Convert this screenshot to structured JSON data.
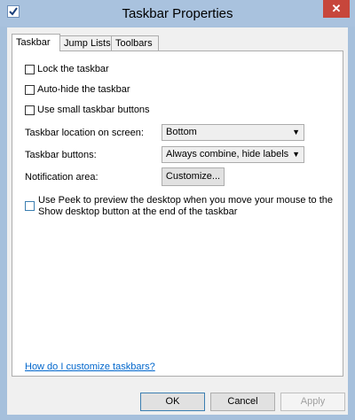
{
  "window": {
    "title": "Taskbar Properties",
    "close_label": "✕",
    "app_icon": "taskbar-properties-icon"
  },
  "tabs": [
    {
      "label": "Taskbar",
      "active": true
    },
    {
      "label": "Jump Lists",
      "active": false
    },
    {
      "label": "Toolbars",
      "active": false
    }
  ],
  "taskbar": {
    "lock_label": "Lock the taskbar",
    "lock_checked": false,
    "autohide_label": "Auto-hide the taskbar",
    "autohide_checked": false,
    "small_buttons_label": "Use small taskbar buttons",
    "small_buttons_checked": false,
    "location_label": "Taskbar location on screen:",
    "location_value": "Bottom",
    "buttons_label": "Taskbar buttons:",
    "buttons_value": "Always combine, hide labels",
    "notification_label": "Notification area:",
    "customize_label": "Customize...",
    "peek_label": "Use Peek to preview the desktop when you move your mouse to the Show desktop button at the end of the taskbar",
    "peek_checked": false,
    "help_link": "How do I customize taskbars?"
  },
  "footer": {
    "ok_label": "OK",
    "cancel_label": "Cancel",
    "apply_label": "Apply"
  }
}
